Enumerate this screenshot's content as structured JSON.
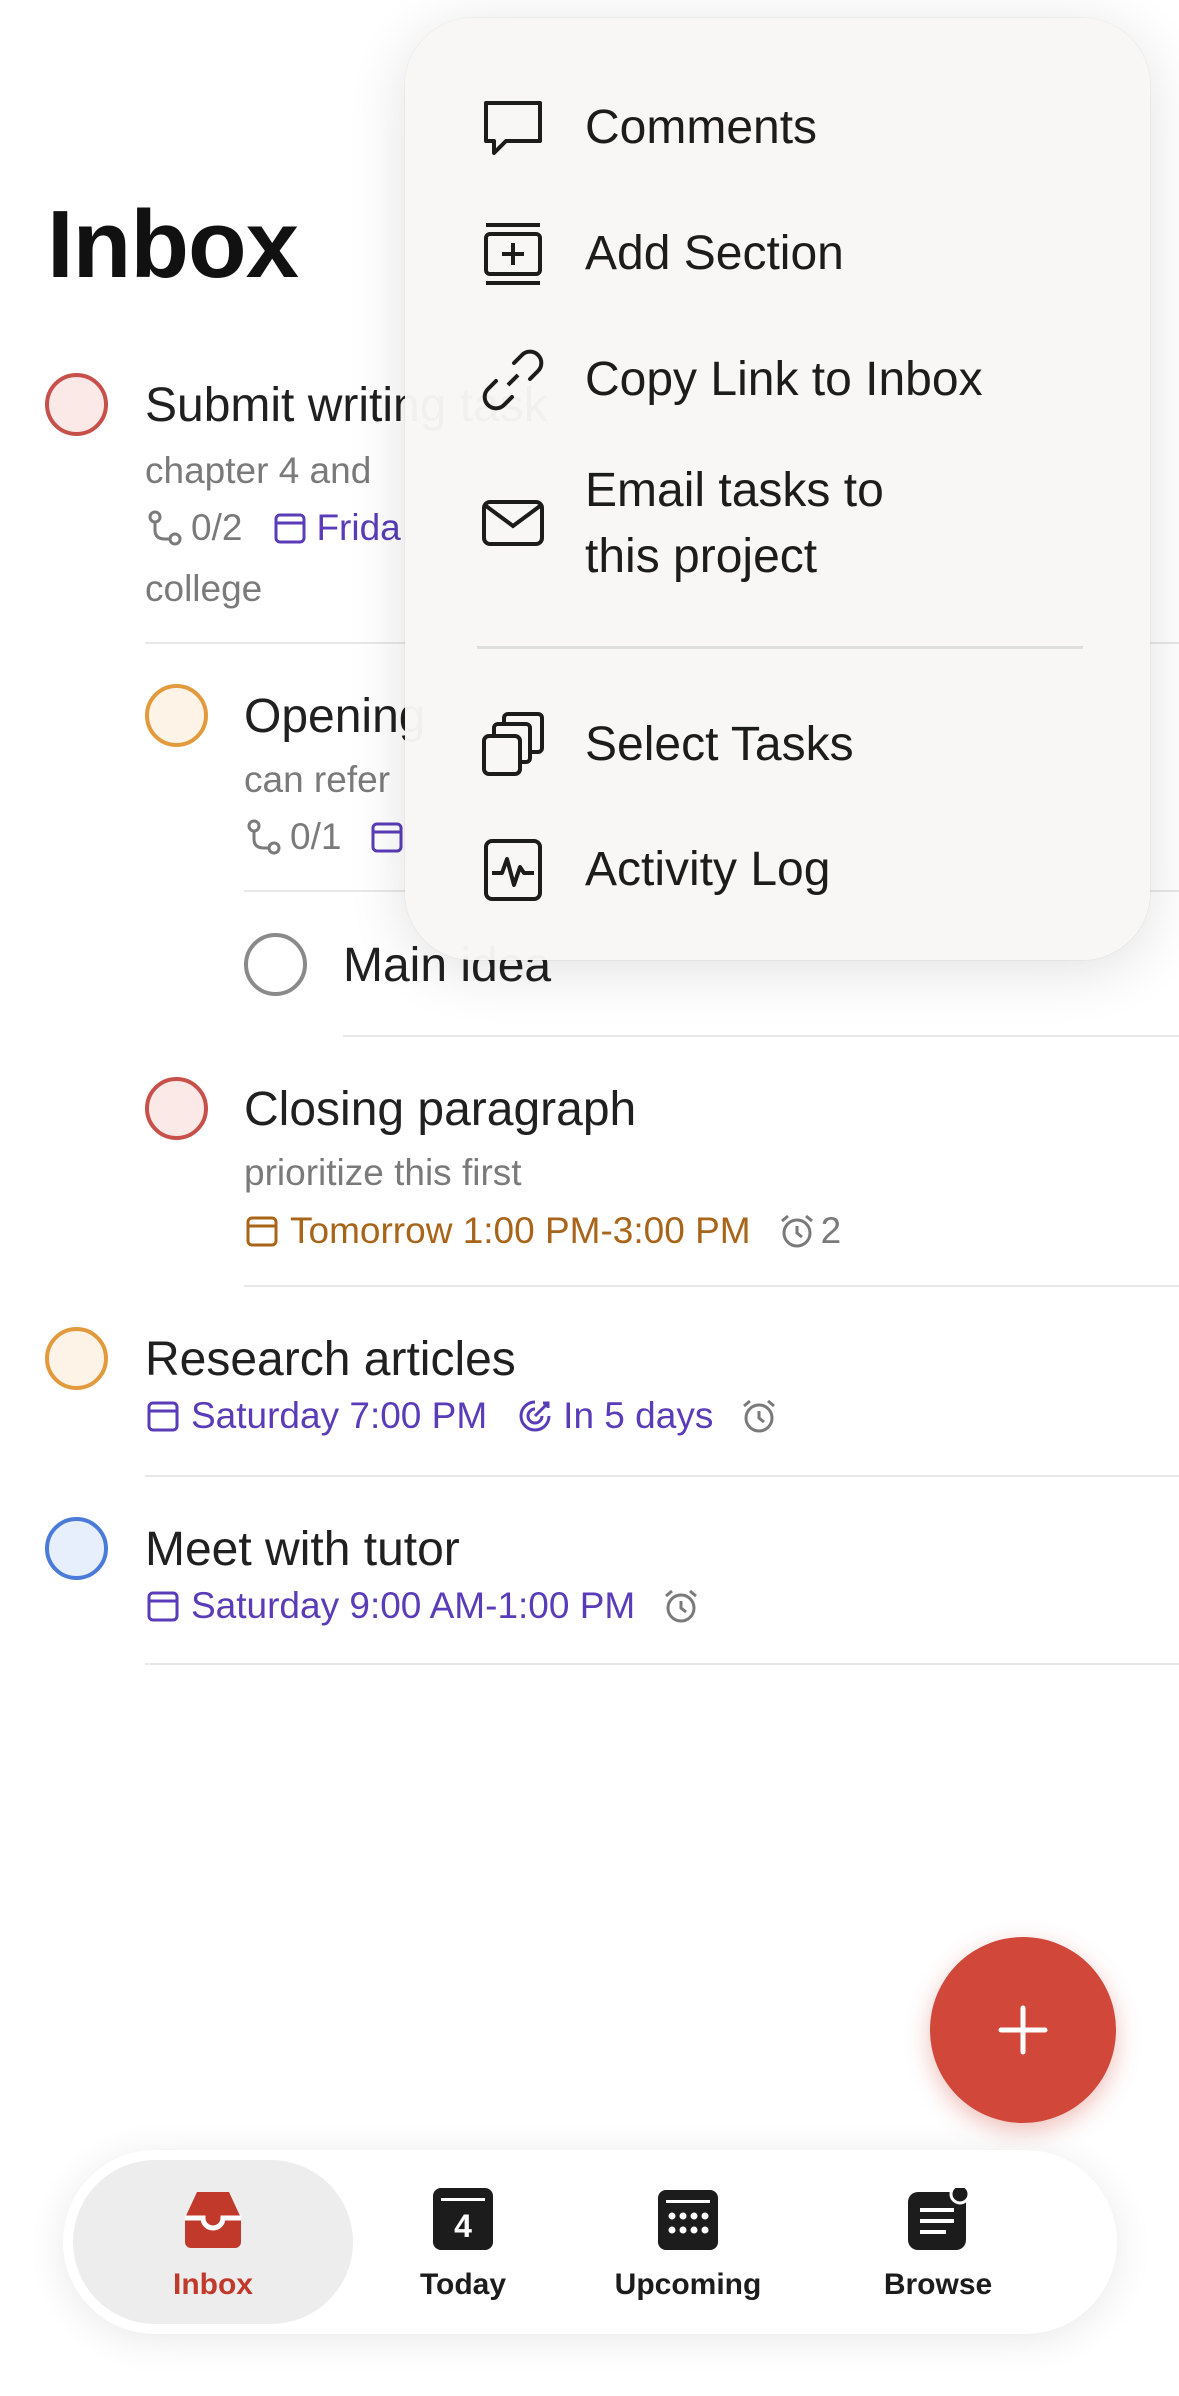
{
  "page": {
    "title": "Inbox"
  },
  "tasks": [
    {
      "title": "Submit writing task",
      "description": "chapter 4 and",
      "subtasks": "0/2",
      "date": "Frida",
      "project": "college",
      "priority": "p1"
    },
    {
      "title": "Opening",
      "description": "can refer",
      "subtasks": "0/1",
      "priority": "p2"
    },
    {
      "title": "Main idea",
      "priority": "p4"
    },
    {
      "title": "Closing paragraph",
      "description": "prioritize this first",
      "date": "Tomorrow 1:00 PM-3:00 PM",
      "reminders": "2",
      "priority": "p1"
    },
    {
      "title": "Research articles",
      "date": "Saturday 7:00 PM",
      "deadline": "In 5 days",
      "priority": "p2"
    },
    {
      "title": "Meet with tutor",
      "date": "Saturday 9:00 AM-1:00 PM",
      "priority": "p3"
    }
  ],
  "menu": {
    "items": [
      {
        "label": "Comments",
        "icon": "comment-icon"
      },
      {
        "label": "Add Section",
        "icon": "add-section-icon"
      },
      {
        "label": "Copy Link to Inbox",
        "icon": "link-icon"
      },
      {
        "label_line1": "Email tasks to",
        "label_line2": "this project",
        "icon": "mail-icon"
      },
      {
        "label": "Select Tasks",
        "icon": "select-tasks-icon"
      },
      {
        "label": "Activity Log",
        "icon": "activity-log-icon"
      }
    ]
  },
  "fab": {
    "icon": "plus-icon"
  },
  "tabbar": {
    "tabs": [
      {
        "label": "Inbox",
        "icon": "inbox-tray-icon",
        "active": true
      },
      {
        "label": "Today",
        "icon": "today-calendar-icon",
        "day": "4"
      },
      {
        "label": "Upcoming",
        "icon": "upcoming-calendar-icon"
      },
      {
        "label": "Browse",
        "icon": "browse-list-icon"
      }
    ]
  },
  "colors": {
    "accent": "#d1473a",
    "purple_date": "#5a3cb8",
    "orange_date": "#a8651a",
    "p1": "#c8504a",
    "p2": "#e29a3c",
    "p3": "#4b7bd8"
  }
}
